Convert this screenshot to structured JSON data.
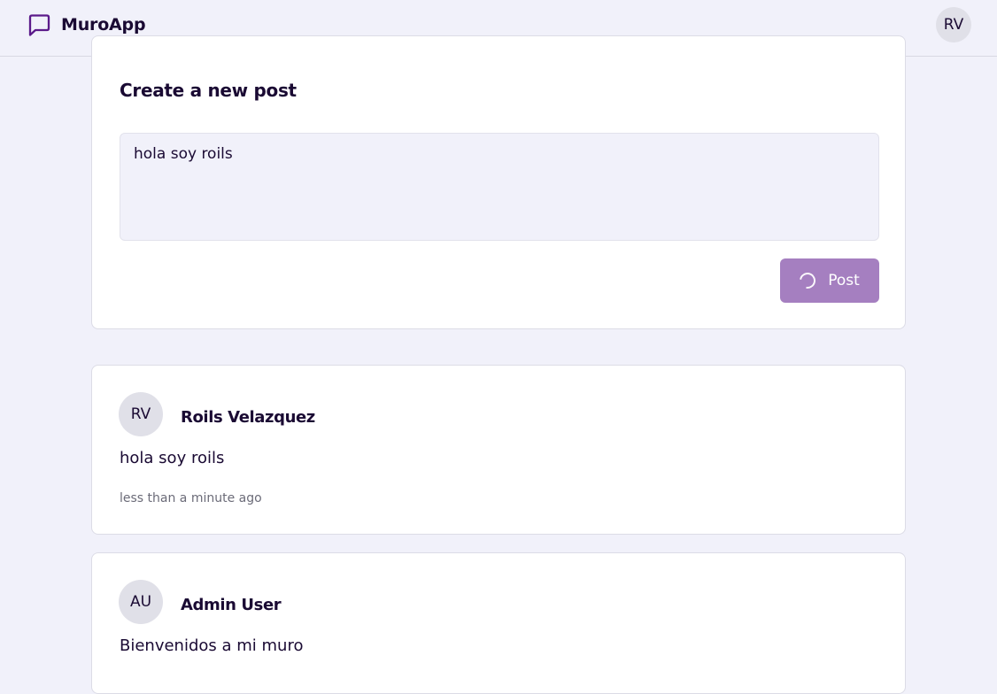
{
  "app": {
    "name": "MuroApp",
    "logo_icon": "message-square-icon",
    "brand_color": "#5b1a8a"
  },
  "header": {
    "user_initials": "RV"
  },
  "composer": {
    "title": "Create a new post",
    "text_value": "hola soy roils",
    "post_label": "Post",
    "button_state": "loading",
    "button_color": "#a57fc0"
  },
  "posts": [
    {
      "initials": "RV",
      "author": "Roils Velazquez",
      "content": "hola soy roils",
      "time": "less than a minute ago"
    },
    {
      "initials": "AU",
      "author": "Admin User",
      "content": "Bienvenidos a mi muro",
      "time": ""
    }
  ]
}
